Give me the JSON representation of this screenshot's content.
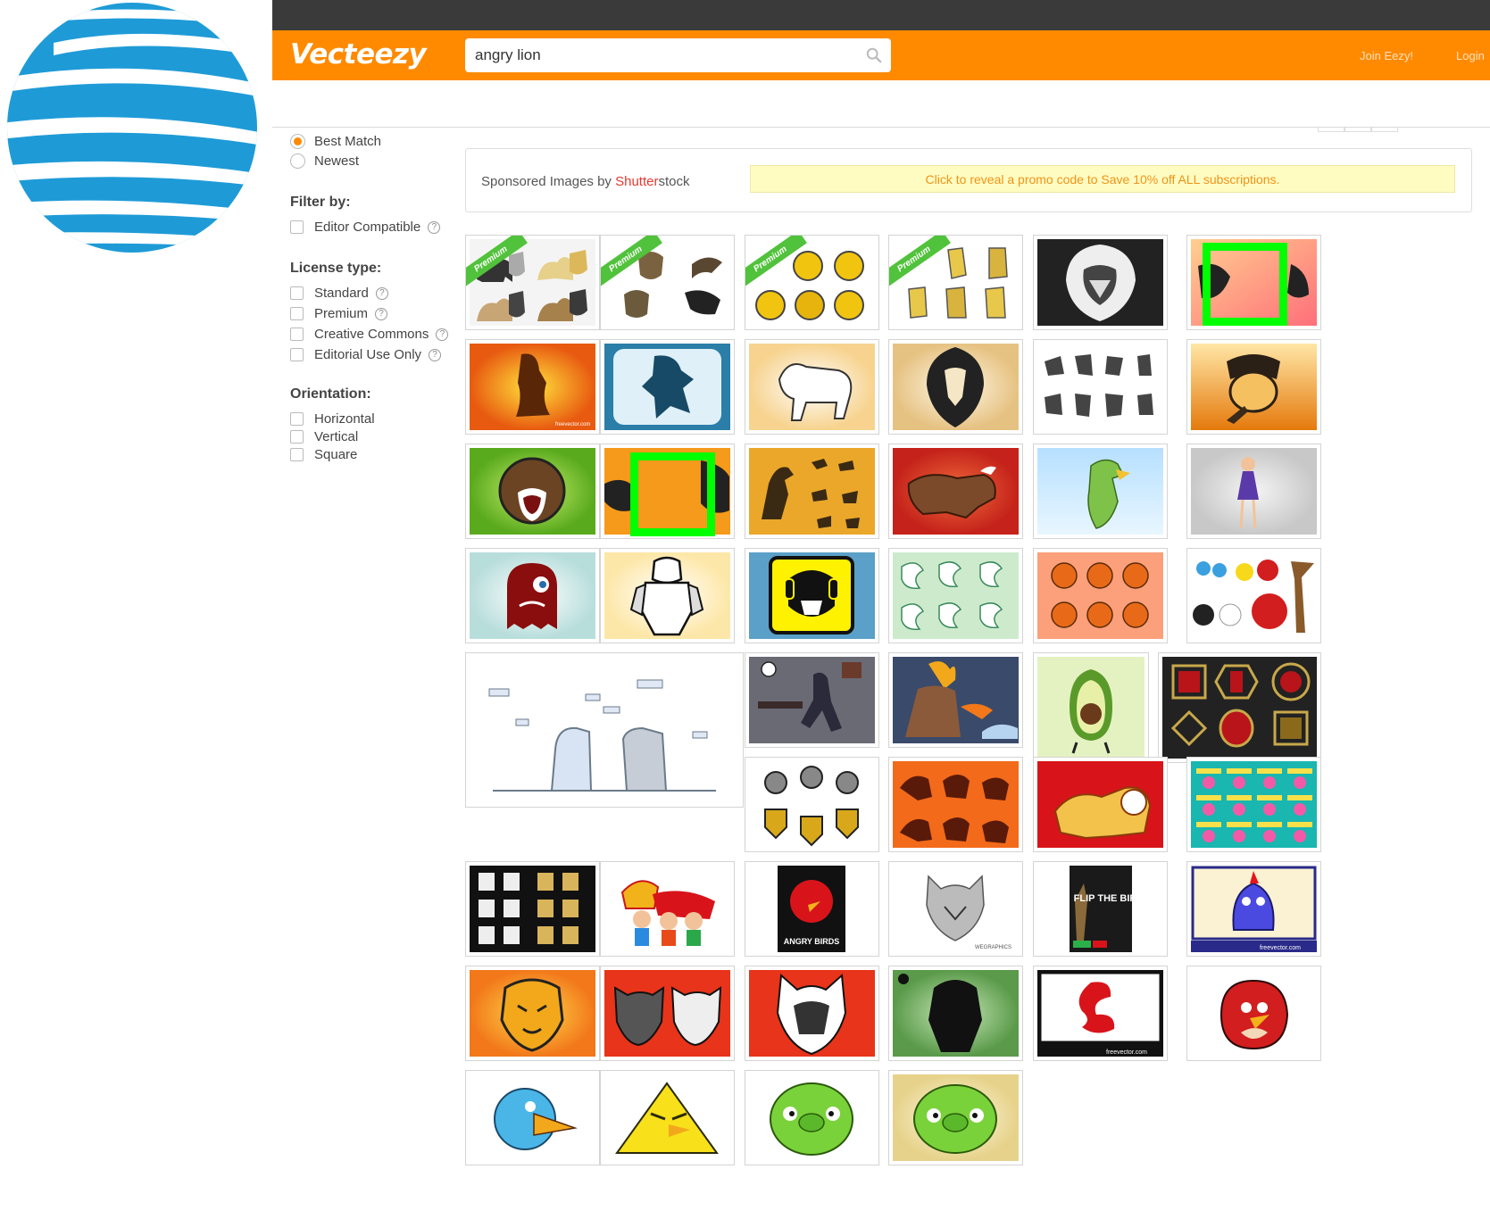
{
  "header": {
    "brand": "Vecteezy",
    "search_value": "angry lion",
    "join_label": "Join Eezy!",
    "login_label": "Login"
  },
  "sort": {
    "best_match": "Best Match",
    "newest": "Newest",
    "selected": "Best Match"
  },
  "filters": {
    "heading": "Filter by:",
    "editor_compatible": "Editor Compatible"
  },
  "license": {
    "heading": "License type:",
    "standard": "Standard",
    "premium": "Premium",
    "creative_commons": "Creative Commons",
    "editorial": "Editorial Use Only"
  },
  "orientation": {
    "heading": "Orientation:",
    "horizontal": "Horizontal",
    "vertical": "Vertical",
    "square": "Square"
  },
  "sponsored": {
    "prefix": "Sponsored Images by ",
    "brand_red": "Shutter",
    "brand_rest": "stock",
    "promo": "Click to reveal a promo code to Save 10% off ALL subscriptions."
  },
  "premium_label": "Premium",
  "tile_text": {
    "freevector": "freevector.com",
    "angry_birds": "ANGRY BIRDS",
    "flip_the_bird": "FLIP THE BIRD",
    "wegraphics": "WEGRAPHICS"
  },
  "colors": {
    "header_orange": "#ff8a00",
    "dark_bar": "#3a3a3a",
    "highlight_green": "#00ff00",
    "premium_green": "#51c23b",
    "promo_text": "#f09318",
    "att_blue": "#1e9bd7"
  },
  "icons": {
    "logo": "att-globe-logo",
    "search": "search-icon",
    "help": "question-circle-icon"
  }
}
